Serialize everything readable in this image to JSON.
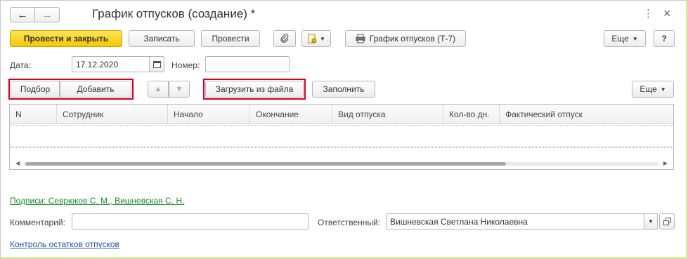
{
  "header": {
    "back_icon": "←",
    "forward_icon": "→",
    "title": "График отпусков (создание) *",
    "more_icon": "⋮",
    "close_icon": "×"
  },
  "toolbar": {
    "post_close": "Провести и закрыть",
    "save": "Записать",
    "post": "Провести",
    "clip_icon": "📎",
    "report_button": "График отпусков (Т-7)",
    "more": "Еще",
    "help": "?"
  },
  "form": {
    "date_label": "Дата:",
    "date_value": "17.12.2020",
    "number_label": "Номер:",
    "number_value": ""
  },
  "table_toolbar": {
    "select": "Подбор",
    "add": "Добавить",
    "load_file": "Загрузить из файла",
    "fill": "Заполнить",
    "more": "Еще"
  },
  "table": {
    "columns": [
      "N",
      "Сотрудник",
      "Начало",
      "Окончание",
      "Вид отпуска",
      "Кол-во дн.",
      "Фактический отпуск"
    ],
    "rows": []
  },
  "footer": {
    "signatures_link": "Подписи: Севрюков С. М., Вишневская С. Н.",
    "comment_label": "Комментарий:",
    "comment_value": "",
    "responsible_label": "Ответственный:",
    "responsible_value": "Вишневская Светлана Николаевна",
    "balance_link": "Контроль остатков отпусков"
  }
}
